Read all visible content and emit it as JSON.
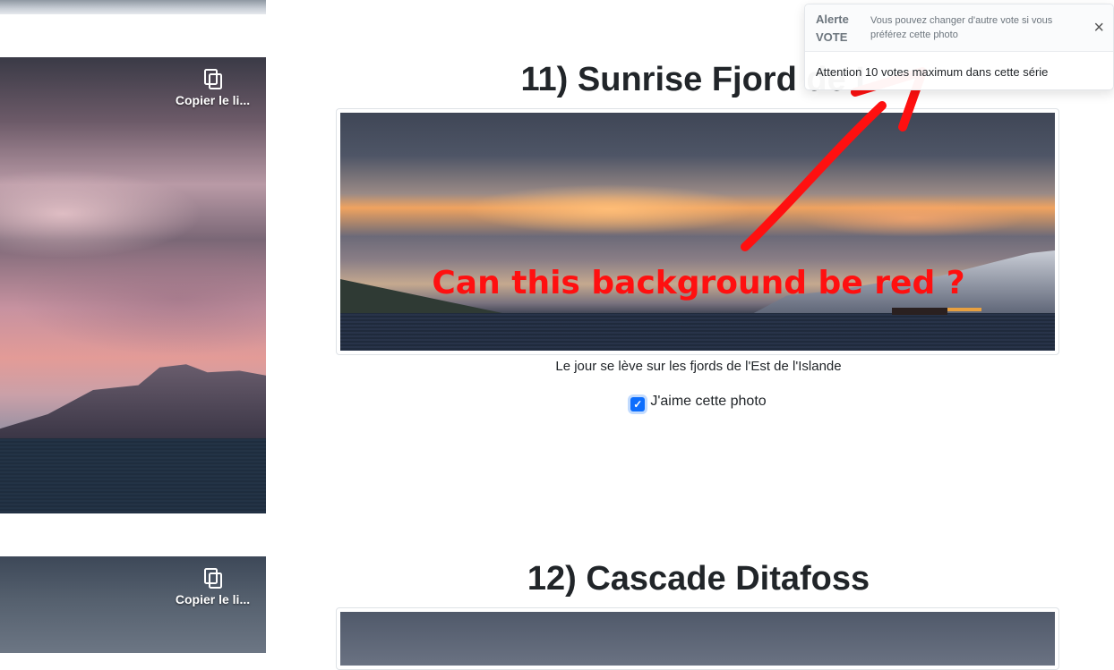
{
  "left_thumbs": [
    {
      "copy_label": "Copier le li..."
    },
    {
      "copy_label": "Copier le li..."
    }
  ],
  "photos": [
    {
      "title": "11)  Sunrise Fjord de L",
      "caption": "Le jour se lève sur les fjords de l'Est de l'Islande",
      "like_label": "J'aime cette photo",
      "liked": true
    },
    {
      "title": "12)  Cascade Ditafoss"
    }
  ],
  "annotation": {
    "text": "Can this background be red ?",
    "color": "#ff1010"
  },
  "toast": {
    "title_line1": "Alerte",
    "title_line2": "VOTE",
    "subtitle": "Vous pouvez changer d'autre vote si vous préférez cette photo",
    "close": "×",
    "body": "Attention 10 votes maximum dans cette série"
  },
  "colors": {
    "checkbox": "#0d6efd",
    "text": "#212529",
    "muted": "#6c757d"
  },
  "icons": [
    "copy-icon",
    "check-icon",
    "close-icon"
  ]
}
